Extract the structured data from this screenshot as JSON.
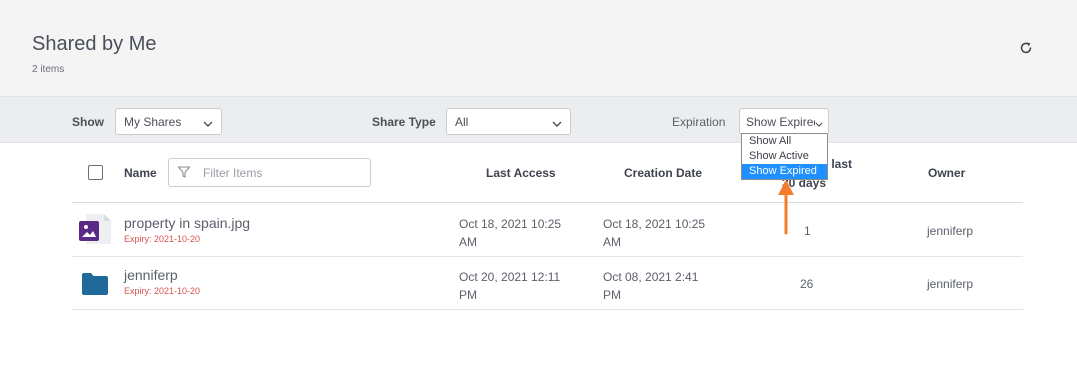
{
  "header": {
    "title": "Shared by Me",
    "count": "2 items"
  },
  "filters": {
    "show_label": "Show",
    "show_value": "My Shares",
    "share_type_label": "Share Type",
    "share_type_value": "All",
    "expiration_label": "Expiration",
    "expiration_value": "Show Expired",
    "expiration_options": [
      "Show All",
      "Show Active",
      "Show Expired"
    ]
  },
  "table": {
    "col_name": "Name",
    "filter_placeholder": "Filter Items",
    "col_last_access": "Last Access",
    "col_creation_date": "Creation Date",
    "col_access_line1": "the last",
    "col_access_line2": "30 days",
    "col_owner": "Owner",
    "rows": [
      {
        "name": "property in spain.jpg",
        "expiry": "Expiry: 2021-10-20",
        "last_access_1": "Oct 18, 2021 10:25",
        "last_access_2": "AM",
        "created_1": "Oct 18, 2021 10:25",
        "created_2": "AM",
        "count": "1",
        "owner": "jenniferp",
        "icon": "image-file-icon"
      },
      {
        "name": "jenniferp",
        "expiry": "Expiry: 2021-10-20",
        "last_access_1": "Oct 20, 2021 12:11",
        "last_access_2": "PM",
        "created_1": "Oct 08, 2021 2:41",
        "created_2": "PM",
        "count": "26",
        "owner": "jenniferp",
        "icon": "folder-icon"
      }
    ]
  },
  "colors": {
    "accent": "#1e90ff",
    "expiry": "#d9534f",
    "folder": "#1f6a99",
    "image_badge": "#5b2a86",
    "arrow": "#f47c2c"
  }
}
